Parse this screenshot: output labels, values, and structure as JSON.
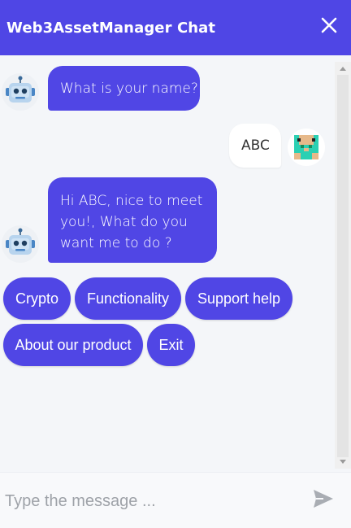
{
  "header": {
    "title": "Web3AssetManager Chat",
    "close_icon": "close-icon"
  },
  "messages": [
    {
      "from": "bot",
      "text": "What is your name?"
    },
    {
      "from": "user",
      "text": "ABC"
    },
    {
      "from": "bot",
      "lines": [
        "Hi ABC, nice to meet",
        "you!, What do you",
        "want me to do ?"
      ]
    }
  ],
  "options": [
    "Crypto",
    "Functionality",
    "Support help",
    "About our product",
    "Exit"
  ],
  "composer": {
    "placeholder": "Type the message ...",
    "send_icon": "send-icon"
  },
  "colors": {
    "accent": "#4f46e5",
    "background": "#f4f6f9"
  }
}
